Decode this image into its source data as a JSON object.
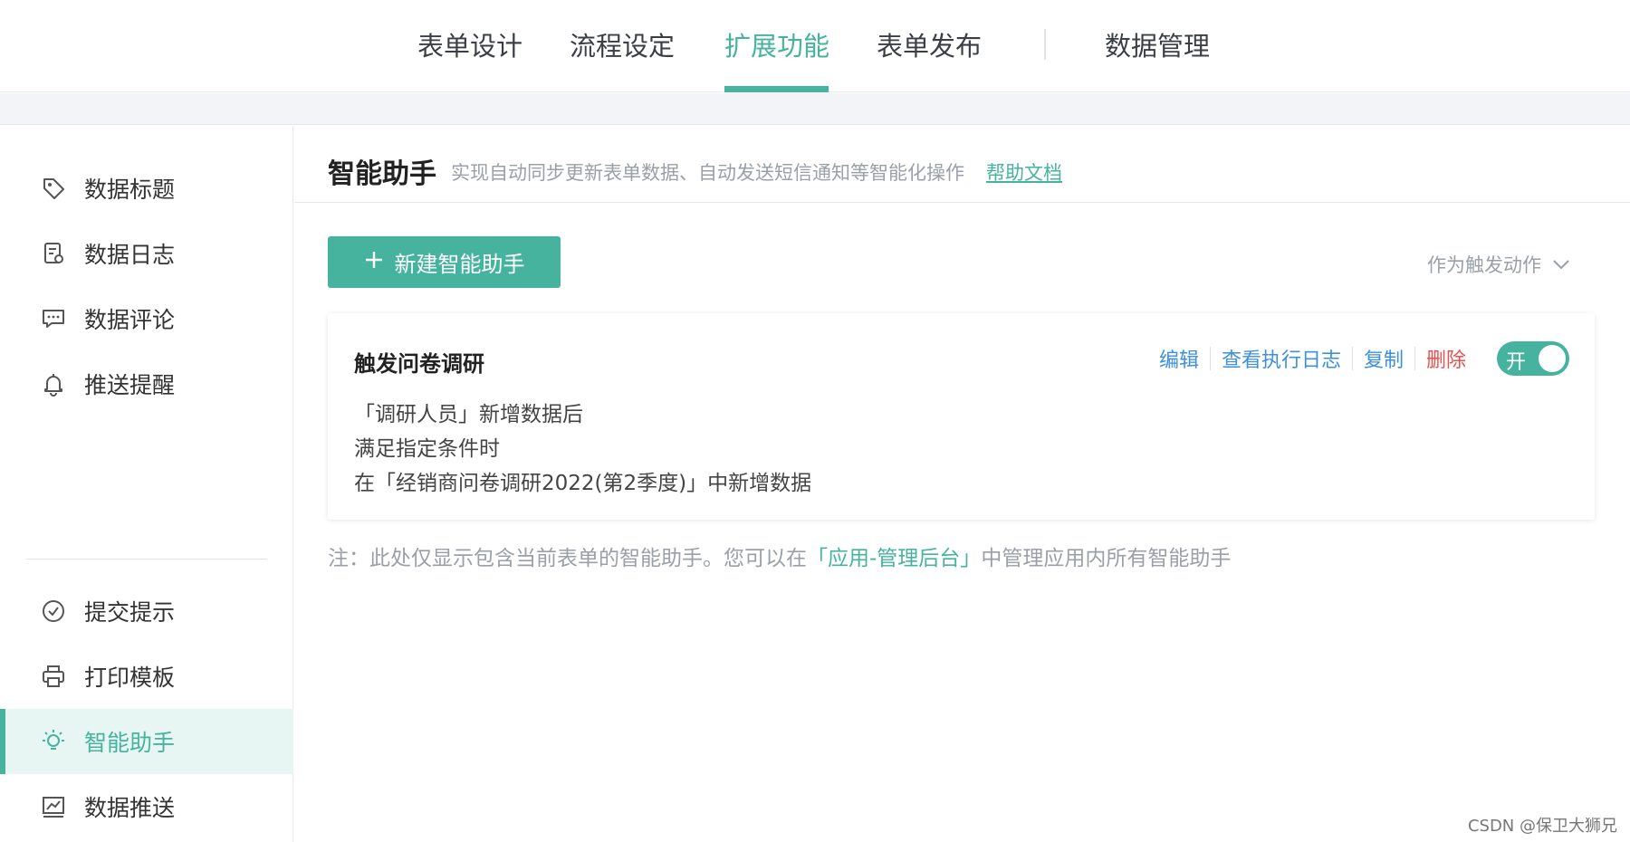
{
  "topnav": {
    "tabs": [
      {
        "label": "表单设计",
        "active": false
      },
      {
        "label": "流程设定",
        "active": false
      },
      {
        "label": "扩展功能",
        "active": true
      },
      {
        "label": "表单发布",
        "active": false
      }
    ],
    "data_manage": "数据管理"
  },
  "sidebar": {
    "items": [
      {
        "label": "数据标题",
        "icon": "tag-icon"
      },
      {
        "label": "数据日志",
        "icon": "log-icon"
      },
      {
        "label": "数据评论",
        "icon": "comment-icon"
      },
      {
        "label": "推送提醒",
        "icon": "bell-icon"
      },
      {
        "label": "提交提示",
        "icon": "check-circle-icon"
      },
      {
        "label": "打印模板",
        "icon": "printer-icon"
      },
      {
        "label": "智能助手",
        "icon": "lightbulb-icon",
        "active": true
      },
      {
        "label": "数据推送",
        "icon": "chart-icon"
      }
    ]
  },
  "main": {
    "title": "智能助手",
    "description": "实现自动同步更新表单数据、自动发送短信通知等智能化操作",
    "help_link": "帮助文档",
    "new_button": "新建智能助手",
    "trigger_filter": "作为触发动作",
    "card": {
      "title": "触发问卷调研",
      "lines": [
        "「调研人员」新增数据后",
        "满足指定条件时",
        "在「经销商问卷调研2022(第2季度)」中新增数据"
      ],
      "actions": {
        "edit": "编辑",
        "view_log": "查看执行日志",
        "copy": "复制",
        "delete": "删除"
      },
      "toggle_label": "开"
    },
    "note": {
      "prefix": "注：此处仅显示包含当前表单的智能助手。您可以在",
      "link": "「应用-管理后台」",
      "suffix": "中管理应用内所有智能助手"
    }
  },
  "watermark": "CSDN @保卫大狮兄",
  "colors": {
    "accent": "#46b39f",
    "link_blue": "#3d8fe0",
    "danger": "#e8504c",
    "muted": "#9aa0a8"
  }
}
